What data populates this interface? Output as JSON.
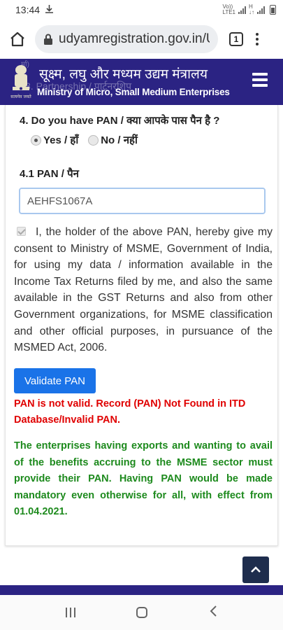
{
  "status_bar": {
    "time": "13:44",
    "network_label": "Vo))\nLTE1"
  },
  "browser": {
    "url": "udyamregistration.gov.in/U",
    "tab_count": "1"
  },
  "site_header": {
    "ghost_text_1": "3. Partnership / पार्टनरशिप",
    "ghost_text_2": "र्मा)",
    "ministry_hindi": "सूक्ष्म, लघु और मध्यम उद्यम मंत्रालय",
    "ministry_english": "Ministry of Micro, Small Medium Enterprises",
    "emblem_caption": "सत्यमेव जयते"
  },
  "form": {
    "q4_label": "4. Do you have PAN / क्या आपके पास पैन है ?",
    "radio_yes": "Yes / हाँ",
    "radio_no": "No / नहीं",
    "radio_selected": "yes",
    "q41_label": "4.1 PAN / पैन",
    "pan_value": "AEHFS1067A",
    "consent_text": "I, the holder of the above PAN, hereby give my consent to Ministry of MSME, Government of India, for using my data / information available in the Income Tax Returns filed by me, and also the same available in the GST Returns and also from other Government organizations, for MSME classification and other official purposes, in pursuance of the MSMED Act, 2006.",
    "validate_label": "Validate PAN",
    "error_text": "PAN is not valid. Record (PAN) Not Found in ITD Database/Invalid PAN.",
    "info_text": "The enterprises having exports and wanting to avail of the benefits accruing to the MSME sector must provide their PAN. Having PAN would be made mandatory even otherwise for all, with effect from 01.04.2021."
  },
  "colors": {
    "header_bg": "#2b2383",
    "button_blue": "#1a73e8",
    "error_red": "#e00000",
    "info_green": "#1d8a1d"
  }
}
